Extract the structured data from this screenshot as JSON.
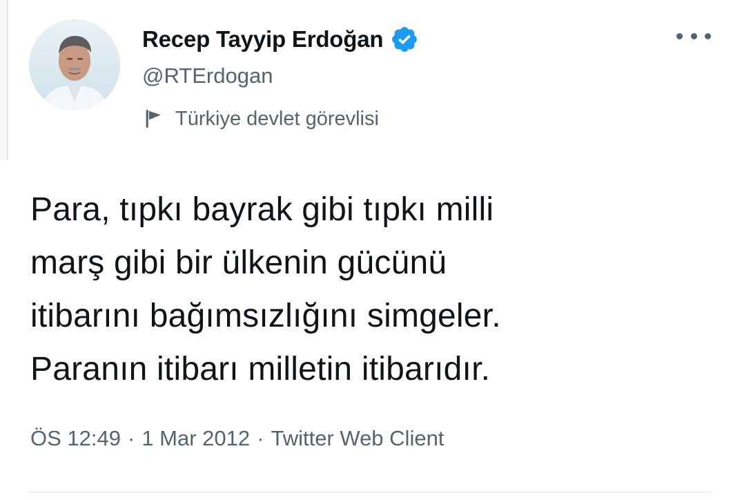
{
  "author": {
    "display_name": "Recep Tayyip Erdoğan",
    "handle": "@RTErdogan",
    "verified_icon": "verified-badge-icon",
    "label": "Türkiye devlet görevlisi",
    "label_icon": "flag-icon"
  },
  "tweet": {
    "lines": [
      "Para, tıpkı bayrak gibi tıpkı milli",
      "marş gibi bir ülkenin gücünü",
      "itibarını bağımsızlığını simgeler.",
      "Paranın itibarı milletin itibarıdır."
    ]
  },
  "meta": {
    "time": "ÖS 12:49",
    "separator": "·",
    "date": "1 Mar 2012",
    "source": "Twitter Web Client"
  },
  "colors": {
    "text": "#0f1419",
    "secondary": "#536471",
    "verified": "#1d9bf0"
  }
}
